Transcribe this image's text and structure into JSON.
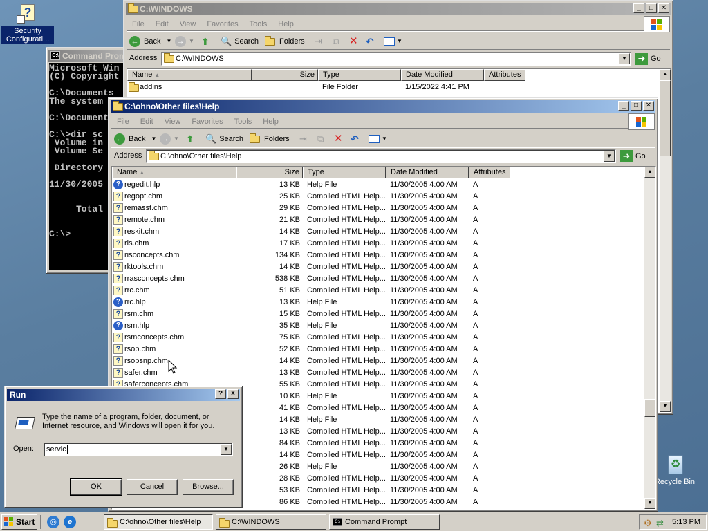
{
  "desktop": {
    "icons": {
      "security": "Security Configurati...",
      "recycle": "Recycle Bin"
    }
  },
  "cmd": {
    "title": "Command Prompt",
    "lines": [
      "Microsoft Win",
      "(C) Copyright",
      "",
      "C:\\Documents",
      "The system",
      "",
      "C:\\Document",
      "",
      "C:\\>dir sc",
      " Volume in",
      " Volume Se",
      "",
      " Directory",
      "",
      "11/30/2005",
      "",
      "",
      "     Total",
      "",
      "",
      "C:\\>"
    ]
  },
  "win_windows": {
    "title": "C:\\WINDOWS",
    "menu": [
      "File",
      "Edit",
      "View",
      "Favorites",
      "Tools",
      "Help"
    ],
    "toolbar": {
      "back": "Back",
      "search": "Search",
      "folders": "Folders"
    },
    "address_label": "Address",
    "address_value": "C:\\WINDOWS",
    "go": "Go",
    "columns": [
      "Name",
      "Size",
      "Type",
      "Date Modified",
      "Attributes"
    ],
    "rows": [
      {
        "name": "addins",
        "size": "",
        "type": "File Folder",
        "date": "1/15/2022 4:41 PM",
        "attr": ""
      }
    ]
  },
  "win_help": {
    "title": "C:\\ohno\\Other files\\Help",
    "menu": [
      "File",
      "Edit",
      "View",
      "Favorites",
      "Tools",
      "Help"
    ],
    "toolbar": {
      "back": "Back",
      "search": "Search",
      "folders": "Folders"
    },
    "address_label": "Address",
    "address_value": "C:\\ohno\\Other files\\Help",
    "go": "Go",
    "columns": [
      "Name",
      "Size",
      "Type",
      "Date Modified",
      "Attributes"
    ],
    "rows": [
      {
        "icon": "hlp",
        "name": "regedit.hlp",
        "size": "13 KB",
        "type": "Help File",
        "date": "11/30/2005 4:00 AM",
        "attr": "A"
      },
      {
        "icon": "chm",
        "name": "regopt.chm",
        "size": "25 KB",
        "type": "Compiled HTML Help...",
        "date": "11/30/2005 4:00 AM",
        "attr": "A"
      },
      {
        "icon": "chm",
        "name": "remasst.chm",
        "size": "29 KB",
        "type": "Compiled HTML Help...",
        "date": "11/30/2005 4:00 AM",
        "attr": "A"
      },
      {
        "icon": "chm",
        "name": "remote.chm",
        "size": "21 KB",
        "type": "Compiled HTML Help...",
        "date": "11/30/2005 4:00 AM",
        "attr": "A"
      },
      {
        "icon": "chm",
        "name": "reskit.chm",
        "size": "14 KB",
        "type": "Compiled HTML Help...",
        "date": "11/30/2005 4:00 AM",
        "attr": "A"
      },
      {
        "icon": "chm",
        "name": "ris.chm",
        "size": "17 KB",
        "type": "Compiled HTML Help...",
        "date": "11/30/2005 4:00 AM",
        "attr": "A"
      },
      {
        "icon": "chm",
        "name": "risconcepts.chm",
        "size": "134 KB",
        "type": "Compiled HTML Help...",
        "date": "11/30/2005 4:00 AM",
        "attr": "A"
      },
      {
        "icon": "chm",
        "name": "rktools.chm",
        "size": "14 KB",
        "type": "Compiled HTML Help...",
        "date": "11/30/2005 4:00 AM",
        "attr": "A"
      },
      {
        "icon": "chm",
        "name": "rrasconcepts.chm",
        "size": "538 KB",
        "type": "Compiled HTML Help...",
        "date": "11/30/2005 4:00 AM",
        "attr": "A"
      },
      {
        "icon": "chm",
        "name": "rrc.chm",
        "size": "51 KB",
        "type": "Compiled HTML Help...",
        "date": "11/30/2005 4:00 AM",
        "attr": "A"
      },
      {
        "icon": "hlp",
        "name": "rrc.hlp",
        "size": "13 KB",
        "type": "Help File",
        "date": "11/30/2005 4:00 AM",
        "attr": "A"
      },
      {
        "icon": "chm",
        "name": "rsm.chm",
        "size": "15 KB",
        "type": "Compiled HTML Help...",
        "date": "11/30/2005 4:00 AM",
        "attr": "A"
      },
      {
        "icon": "hlp",
        "name": "rsm.hlp",
        "size": "35 KB",
        "type": "Help File",
        "date": "11/30/2005 4:00 AM",
        "attr": "A"
      },
      {
        "icon": "chm",
        "name": "rsmconcepts.chm",
        "size": "75 KB",
        "type": "Compiled HTML Help...",
        "date": "11/30/2005 4:00 AM",
        "attr": "A"
      },
      {
        "icon": "chm",
        "name": "rsop.chm",
        "size": "52 KB",
        "type": "Compiled HTML Help...",
        "date": "11/30/2005 4:00 AM",
        "attr": "A"
      },
      {
        "icon": "chm",
        "name": "rsopsnp.chm",
        "size": "14 KB",
        "type": "Compiled HTML Help...",
        "date": "11/30/2005 4:00 AM",
        "attr": "A"
      },
      {
        "icon": "chm",
        "name": "safer.chm",
        "size": "13 KB",
        "type": "Compiled HTML Help...",
        "date": "11/30/2005 4:00 AM",
        "attr": "A"
      },
      {
        "icon": "chm",
        "name": "saferconcepts.chm",
        "size": "55 KB",
        "type": "Compiled HTML Help...",
        "date": "11/30/2005 4:00 AM",
        "attr": "A"
      },
      {
        "icon": "hlp",
        "name": "",
        "size": "10 KB",
        "type": "Help File",
        "date": "11/30/2005 4:00 AM",
        "attr": "A"
      },
      {
        "icon": "chm",
        "name": "",
        "size": "41 KB",
        "type": "Compiled HTML Help...",
        "date": "11/30/2005 4:00 AM",
        "attr": "A"
      },
      {
        "icon": "hlp",
        "name": "",
        "size": "14 KB",
        "type": "Help File",
        "date": "11/30/2005 4:00 AM",
        "attr": "A"
      },
      {
        "icon": "chm",
        "name": "",
        "size": "13 KB",
        "type": "Compiled HTML Help...",
        "date": "11/30/2005 4:00 AM",
        "attr": "A"
      },
      {
        "icon": "chm",
        "name": "",
        "size": "84 KB",
        "type": "Compiled HTML Help...",
        "date": "11/30/2005 4:00 AM",
        "attr": "A"
      },
      {
        "icon": "chm",
        "name": "",
        "size": "14 KB",
        "type": "Compiled HTML Help...",
        "date": "11/30/2005 4:00 AM",
        "attr": "A"
      },
      {
        "icon": "hlp",
        "name": "",
        "size": "26 KB",
        "type": "Help File",
        "date": "11/30/2005 4:00 AM",
        "attr": "A"
      },
      {
        "icon": "chm",
        "name": "",
        "size": "28 KB",
        "type": "Compiled HTML Help...",
        "date": "11/30/2005 4:00 AM",
        "attr": "A"
      },
      {
        "icon": "chm",
        "name": "",
        "size": "53 KB",
        "type": "Compiled HTML Help...",
        "date": "11/30/2005 4:00 AM",
        "attr": "A"
      },
      {
        "icon": "chm",
        "name": "",
        "size": "86 KB",
        "type": "Compiled HTML Help...",
        "date": "11/30/2005 4:00 AM",
        "attr": "A"
      }
    ]
  },
  "run": {
    "title": "Run",
    "help_btn": "?",
    "close_btn": "X",
    "description": "Type the name of a program, folder, document, or Internet resource, and Windows will open it for you.",
    "open_label": "Open:",
    "open_value": "servic",
    "ok": "OK",
    "cancel": "Cancel",
    "browse": "Browse..."
  },
  "taskbar": {
    "start": "Start",
    "tasks": [
      "C:\\ohno\\Other files\\Help",
      "C:\\WINDOWS",
      "Command Prompt"
    ],
    "clock": "5:13 PM"
  }
}
